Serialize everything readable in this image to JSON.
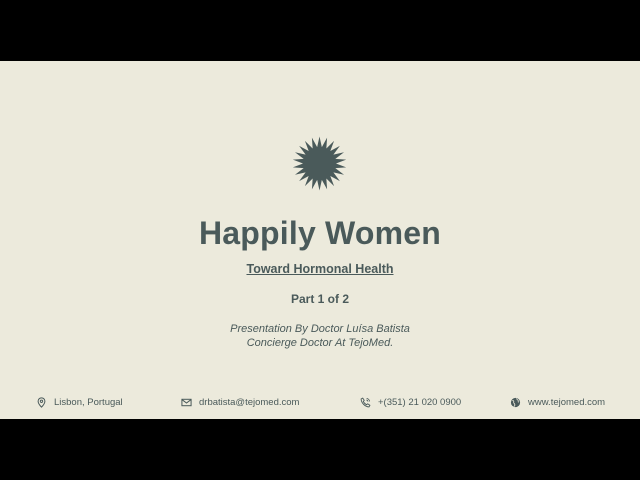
{
  "slide": {
    "logo_icon": "starburst-icon",
    "title": "Happily Women",
    "subtitle": "Toward Hormonal Health",
    "part": "Part 1 of 2",
    "presenter_line1": "Presentation By Doctor Luísa Batista",
    "presenter_line2": "Concierge Doctor At TejoMed."
  },
  "footer": {
    "location": {
      "icon": "location-pin-icon",
      "text": "Lisbon, Portugal"
    },
    "email": {
      "icon": "envelope-icon",
      "text": "drbatista@tejomed.com"
    },
    "phone": {
      "icon": "phone-icon",
      "text": "+(351) 21 020 0900"
    },
    "website": {
      "icon": "globe-icon",
      "text": "www.tejomed.com"
    }
  },
  "colors": {
    "background": "#eceadc",
    "text": "#4a5a5a",
    "letterbox": "#000000"
  }
}
